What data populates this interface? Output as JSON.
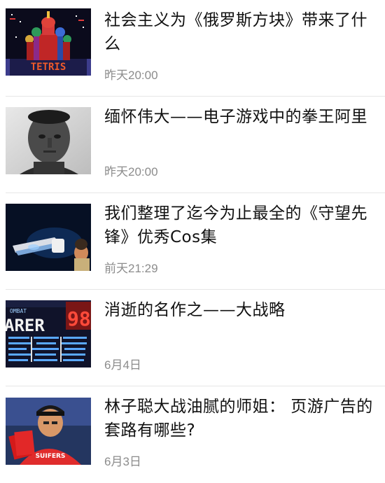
{
  "articles": [
    {
      "title": "社会主义为《俄罗斯方块》带来了什么",
      "date": "昨天20:00",
      "thumbnail": "tetris-kremlin-thumbnail",
      "thumbnail_text": "TETRIS"
    },
    {
      "title": "缅怀伟大——电子游戏中的拳王阿里",
      "date": "昨天20:00",
      "thumbnail": "muhammad-ali-portrait-thumbnail"
    },
    {
      "title": "我们整理了迄今为止最全的《守望先锋》优秀Cos集",
      "date": "前天21:29",
      "thumbnail": "overwatch-cosplay-thumbnail"
    },
    {
      "title": "消逝的名作之——大战略",
      "date": "6月4日",
      "thumbnail": "strategy-game-screen-thumbnail",
      "thumbnail_text_top": "OMBAT",
      "thumbnail_text_main": "ARER",
      "thumbnail_text_num": "98"
    },
    {
      "title": "林子聪大战油腻的师姐： 页游广告的套路有哪些?",
      "date": "6月3日",
      "thumbnail": "man-with-envelope-thumbnail",
      "thumbnail_text": "SUIFERS"
    }
  ]
}
